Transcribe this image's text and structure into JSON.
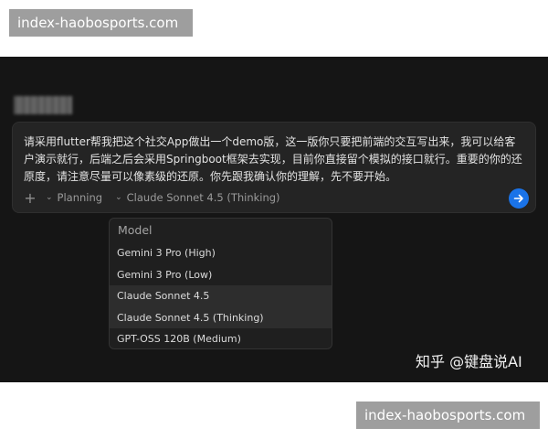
{
  "watermarks": {
    "top": "index-haobosports.com",
    "bottom": "index-haobosports.com"
  },
  "prompt": {
    "text": "请采用flutter帮我把这个社交App做出一个demo版，这一版你只要把前端的交互写出来，我可以给客户演示就行，后端之后会采用Springboot框架去实现，目前你直接留个模拟的接口就行。重要的你的还原度，请注意尽量可以像素级的还原。你先跟我确认你的理解，先不要开始。",
    "mode_label": "Planning",
    "model_label": "Claude Sonnet 4.5 (Thinking)"
  },
  "model_menu": {
    "title": "Model",
    "items": [
      {
        "label": "Gemini 3 Pro (High)"
      },
      {
        "label": "Gemini 3 Pro (Low)"
      },
      {
        "label": "Claude Sonnet 4.5"
      },
      {
        "label": "Claude Sonnet 4.5 (Thinking)"
      },
      {
        "label": "GPT-OSS 120B (Medium)"
      }
    ],
    "highlighted_index": 3
  },
  "credit": "知乎 @键盘说AI",
  "colors": {
    "accent": "#1a73e8",
    "background": "#151515",
    "panel": "#242424"
  }
}
